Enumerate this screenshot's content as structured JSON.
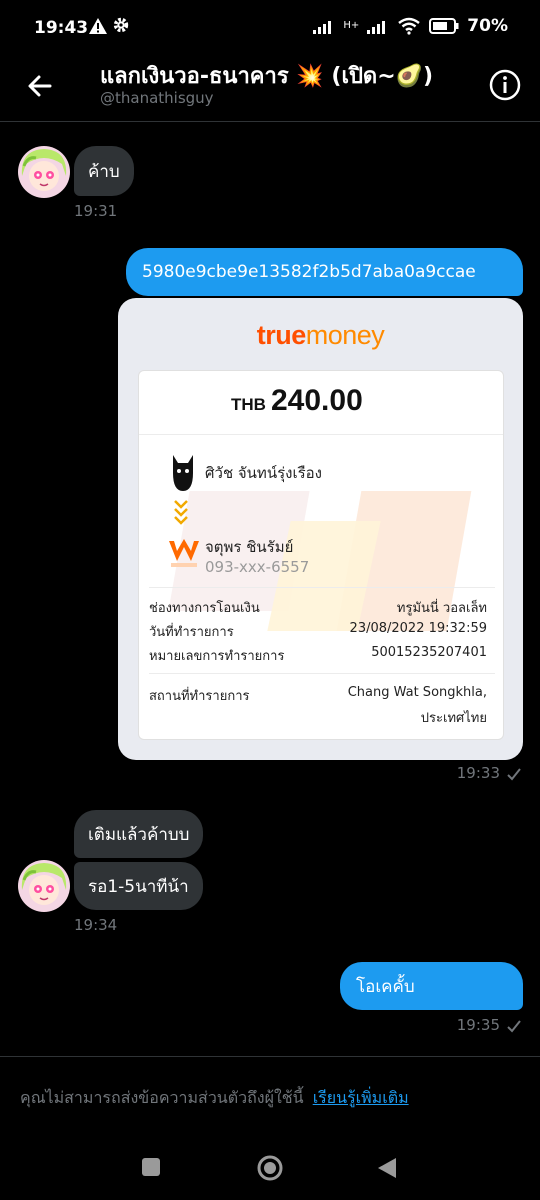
{
  "status_bar": {
    "time": "19:43",
    "network": "H+",
    "battery": "70%"
  },
  "header": {
    "title": "แลกเงินวอ-ธนาคาร 💥 (เปิด~🥑)",
    "handle": "@thanathisguy"
  },
  "messages": {
    "m1": {
      "text": "ค้าบ",
      "time": "19:31"
    },
    "m2": {
      "text": "5980e9cbe9e13582f2b5d7aba0a9ccae"
    },
    "m2_time": "19:33",
    "m3": {
      "text": "เติมแล้วค้าบบ"
    },
    "m4": {
      "text": "รอ1-5นาทีน้า",
      "time": "19:34"
    },
    "m5": {
      "text": "โอเคคั้บ",
      "time": "19:35"
    }
  },
  "receipt": {
    "brand_true": "true",
    "brand_money": "money",
    "currency": "THB",
    "amount": "240.00",
    "sender_name": "ศิวัช จันทน์รุ่งเรือง",
    "receiver_name": "จตุพร ชินรัมย์",
    "receiver_phone": "093-xxx-6557",
    "rows": [
      {
        "label": "ช่องทางการโอนเงิน",
        "value": "ทรูมันนี่ วอลเล็ท"
      },
      {
        "label": "วันที่ทำรายการ",
        "value": "23/08/2022 19:32:59"
      },
      {
        "label": "หมายเลขการทำรายการ",
        "value": "50015235207401"
      }
    ],
    "location_label": "สถานที่ทำรายการ",
    "location_line1": "Chang Wat Songkhla,",
    "location_line2": "ประเทศไทย"
  },
  "footer": {
    "notice": "คุณไม่สามารถส่งข้อความส่วนตัวถึงผู้ใช้นี้",
    "learn_more": "เรียนรู้เพิ่มเติม"
  },
  "colors": {
    "accent": "#1d9bf0",
    "incoming_bubble": "#2f3336",
    "truemoney_orange": "#ff4f00"
  }
}
